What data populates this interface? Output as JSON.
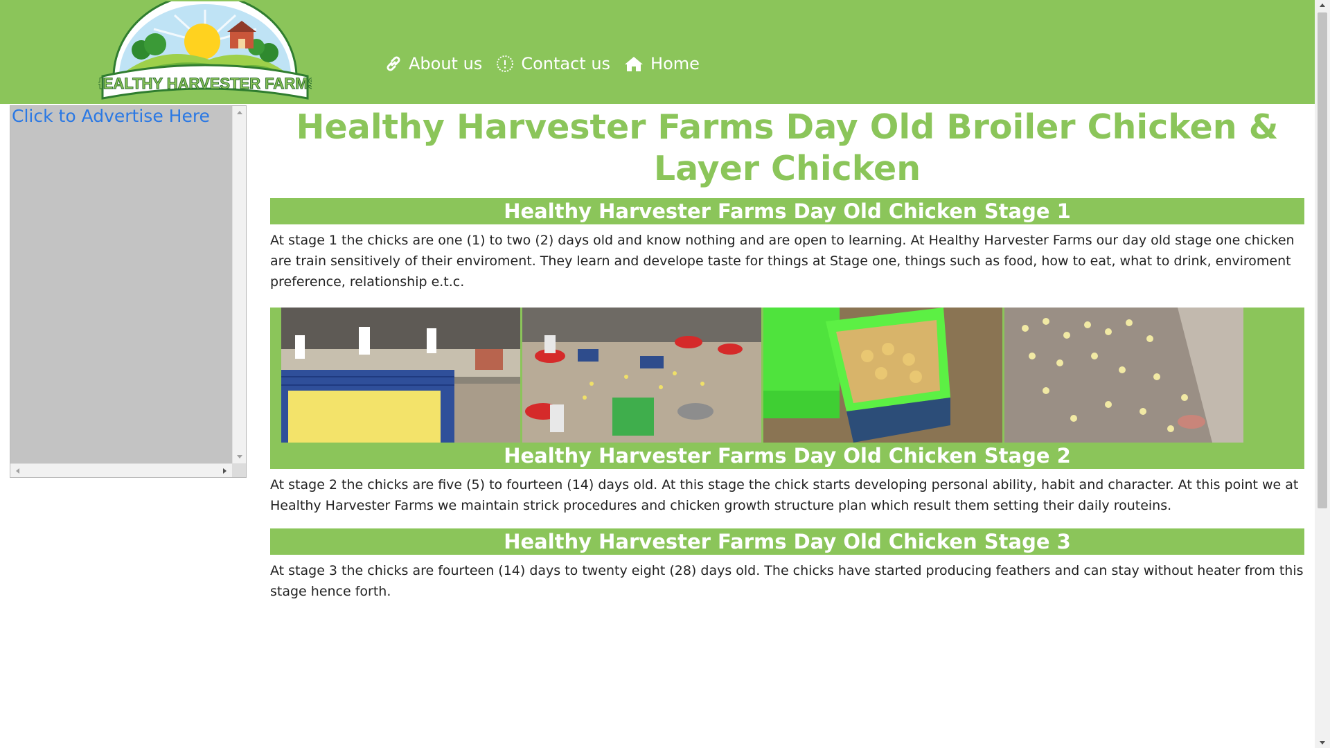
{
  "header": {
    "logo_text": "HEALTHY HARVESTER FARMS",
    "nav": [
      {
        "label": "About us",
        "icon": "link-icon"
      },
      {
        "label": "Contact us",
        "icon": "info-circle-icon"
      },
      {
        "label": "Home",
        "icon": "home-icon"
      }
    ]
  },
  "sidebar": {
    "ad_link": "Click to Advertise Here"
  },
  "main": {
    "title": "Healthy Harvester Farms Day Old Broiler Chicken & Layer Chicken",
    "stages": [
      {
        "heading": "Healthy Harvester Farms Day Old Chicken Stage 1",
        "text": "At stage 1 the chicks are one (1) to two (2) days old and know nothing and are open to learning. At Healthy Harvester Farms our day old stage one chicken are train sensitively of their enviroment. They learn and develope taste for things at Stage one, things such as food, how to eat, what to drink, enviroment preference, relationship e.t.c."
      },
      {
        "heading": "Healthy Harvester Farms Day Old Chicken Stage 2",
        "text": "At stage 2 the chicks are five (5) to fourteen (14) days old. At this stage the chick starts developing personal ability, habit and character. At this point we at Healthy Harvester Farms we maintain strick procedures and chicken growth structure plan which result them setting their daily routeins."
      },
      {
        "heading": "Healthy Harvester Farms Day Old Chicken Stage 3",
        "text": "At stage 3 the chicks are fourteen (14) days to twenty eight (28) days old. The chicks have started producing feathers and can stay without heater from this stage hence forth."
      }
    ],
    "photos": [
      "chicks-in-crates-photo",
      "brooder-feeders-photo",
      "green-baskets-chicks-photo",
      "chicks-on-floor-photo"
    ]
  },
  "colors": {
    "brand_green": "#8bc55a",
    "link_blue": "#2a78e4"
  }
}
